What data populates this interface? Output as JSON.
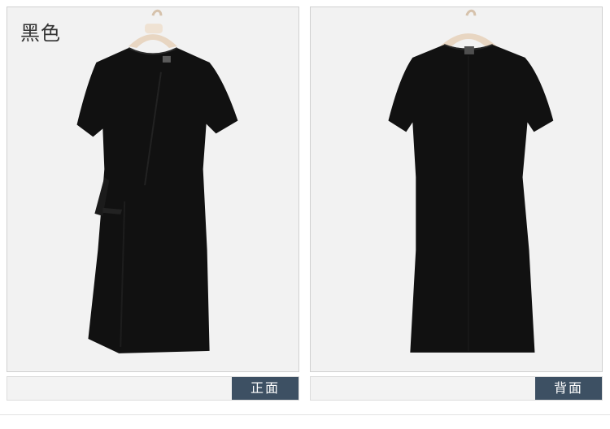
{
  "color_label": "黑色",
  "views": [
    {
      "label": "正面"
    },
    {
      "label": "背面"
    }
  ],
  "colors": {
    "panel_bg": "#f2f2f2",
    "dress": "#111111",
    "hanger": "#e8d6c2",
    "tag_bg": "#3d5063"
  }
}
